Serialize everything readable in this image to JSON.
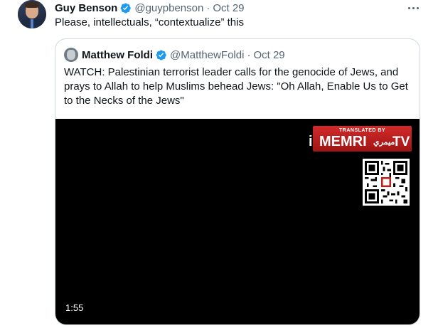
{
  "tweet": {
    "author_name": "Guy Benson",
    "handle": "@guypbenson",
    "separator": "·",
    "time": "Oct 29",
    "text": "Please, intellectuals, “contextualize” this"
  },
  "quote": {
    "author_name": "Matthew Foldi",
    "handle": "@MatthewFoldi",
    "separator": "·",
    "time": "Oct 29",
    "text": "WATCH: Palestinian terrorist leader calls for the genocide of Jews, and prays to Allah to help Muslims behead Jews: \"Oh Allah, Enable Us to Get to the Necks of the Jews\"",
    "video": {
      "duration": "1:55",
      "watermark_top": "TRANSLATED BY",
      "watermark_name": "MEMRI",
      "watermark_arabic": "ميمري",
      "watermark_tv": "TV"
    }
  },
  "colors": {
    "verified_blue": "#1d9bf0",
    "secondary_text": "#536471",
    "border": "#cfd9de",
    "memri_red": "#c21d1d"
  },
  "icons": {
    "verified": "verified-badge-icon",
    "more": "more-options-icon"
  }
}
